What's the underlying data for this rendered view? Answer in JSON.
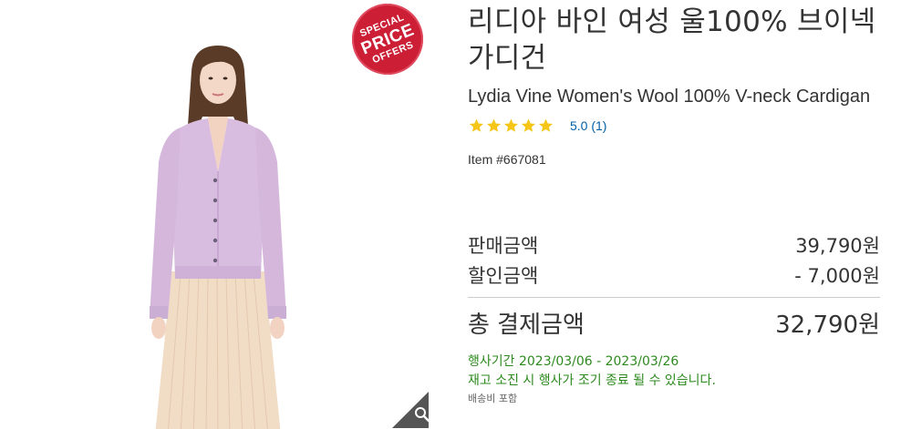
{
  "badge": {
    "line1": "SPECIAL",
    "line2": "PRICE",
    "line3": "OFFERS",
    "color": "#cc1f36"
  },
  "product": {
    "title_ko": "리디아 바인 여성 울100% 브이넥 가디건",
    "title_en": "Lydia Vine Women's Wool 100% V-neck Cardigan",
    "rating_value": 5.0,
    "rating_text": "5.0 (1)",
    "item_number": "Item #667081",
    "star_color": "#f5c518",
    "image_icons": [
      "cardigan-model-image",
      "zoom-icon"
    ]
  },
  "pricing": {
    "sale_label": "판매금액",
    "sale_value": "39,790원",
    "discount_label": "할인금액",
    "discount_value": "- 7,000원",
    "total_label": "총 결제금액",
    "total_value": "32,790원"
  },
  "promotion": {
    "period": "행사기간 2023/03/06 - 2023/03/26",
    "note": "재고 소진 시 행사가 조기 종료 될 수 있습니다.",
    "color": "#2d8a1e"
  },
  "shipping": {
    "text": "배송비 포함"
  }
}
